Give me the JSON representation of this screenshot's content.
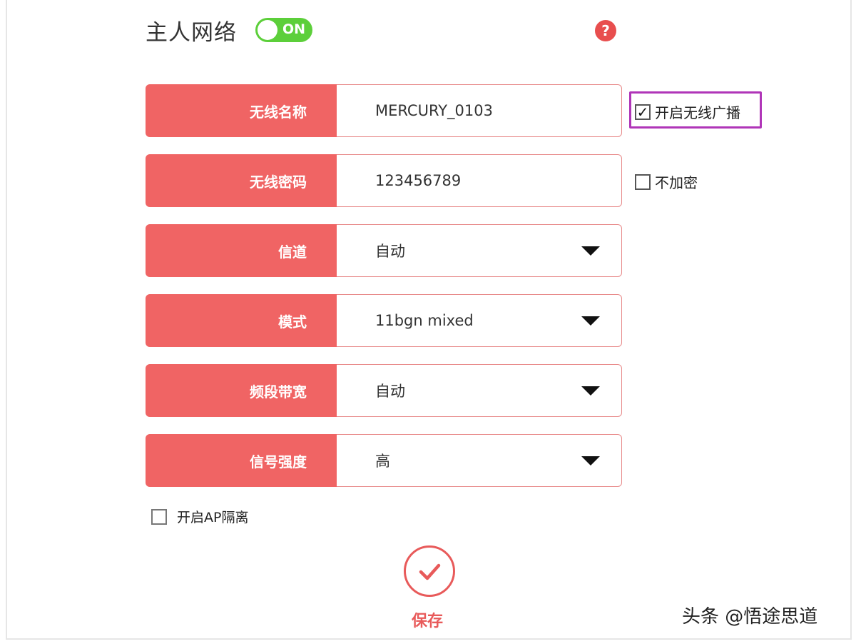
{
  "header": {
    "title": "主人网络",
    "toggle_label": "ON",
    "help_glyph": "?"
  },
  "rows": [
    {
      "label": "无线名称",
      "value": "MERCURY_0103",
      "type": "text"
    },
    {
      "label": "无线密码",
      "value": "123456789",
      "type": "text"
    },
    {
      "label": "信道",
      "value": "自动",
      "type": "select"
    },
    {
      "label": "模式",
      "value": "11bgn mixed",
      "type": "select"
    },
    {
      "label": "频段带宽",
      "value": "自动",
      "type": "select"
    },
    {
      "label": "信号强度",
      "value": "高",
      "type": "select"
    }
  ],
  "options": {
    "broadcast": {
      "label": "开启无线广播",
      "checked": true
    },
    "no_encrypt": {
      "label": "不加密",
      "checked": false
    },
    "ap_isolation": {
      "label": "开启AP隔离",
      "checked": false
    }
  },
  "save": {
    "label": "保存"
  },
  "watermark": "头条 @悟途思道",
  "colors": {
    "label_bg": "#f06464",
    "toggle_on": "#5ccf3a",
    "highlight": "#b035b8",
    "accent": "#e85a5a"
  },
  "icons": {
    "help": "question-circle-icon",
    "save": "check-circle-icon",
    "dropdown": "triangle-down-icon"
  }
}
